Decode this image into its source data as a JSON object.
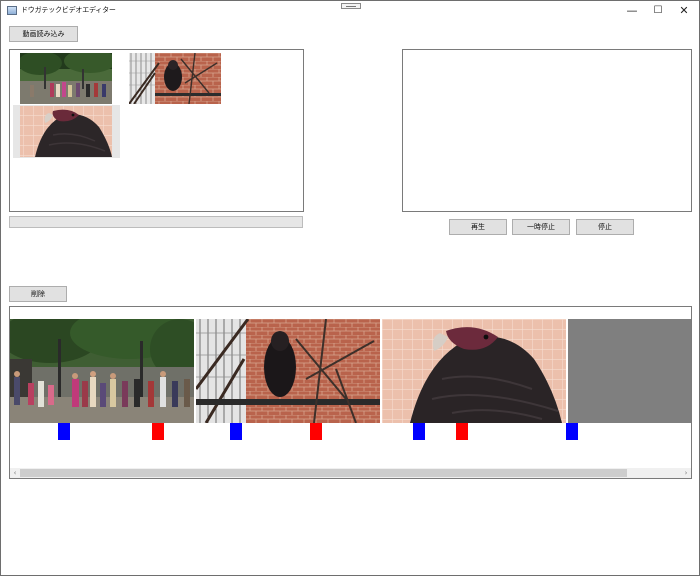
{
  "window": {
    "title": "ドウガテックビデオエディター",
    "minimize_glyph": "—",
    "maximize_glyph": "☐",
    "close_glyph": "✕"
  },
  "toolbar": {
    "load_label": "動画読み込み",
    "delete_label": "削除"
  },
  "player": {
    "play_label": "再生",
    "pause_label": "一時停止",
    "stop_label": "停止"
  },
  "media_bin": {
    "items": [
      {
        "name": "park-crowd-clip",
        "scene": "crowd"
      },
      {
        "name": "bird-cage-clip",
        "scene": "cage"
      },
      {
        "name": "bird-closeup-clip",
        "scene": "closeup",
        "selected": true
      }
    ]
  },
  "load_progress": {
    "value": 0
  },
  "timeline": {
    "frames": [
      "crowd",
      "cage",
      "closeup",
      "empty"
    ],
    "markers": [
      {
        "color": "blue"
      },
      {
        "color": "red"
      },
      {
        "color": "blue"
      },
      {
        "color": "red"
      },
      {
        "color": "blue"
      },
      {
        "color": "red"
      },
      {
        "color": "blue"
      }
    ],
    "scroll_left_glyph": "‹",
    "scroll_right_glyph": "›"
  },
  "colors": {
    "marker_blue": "#0000ff",
    "marker_red": "#ff0000",
    "button_face": "#e1e1e1",
    "progress_green": "#06b025"
  }
}
